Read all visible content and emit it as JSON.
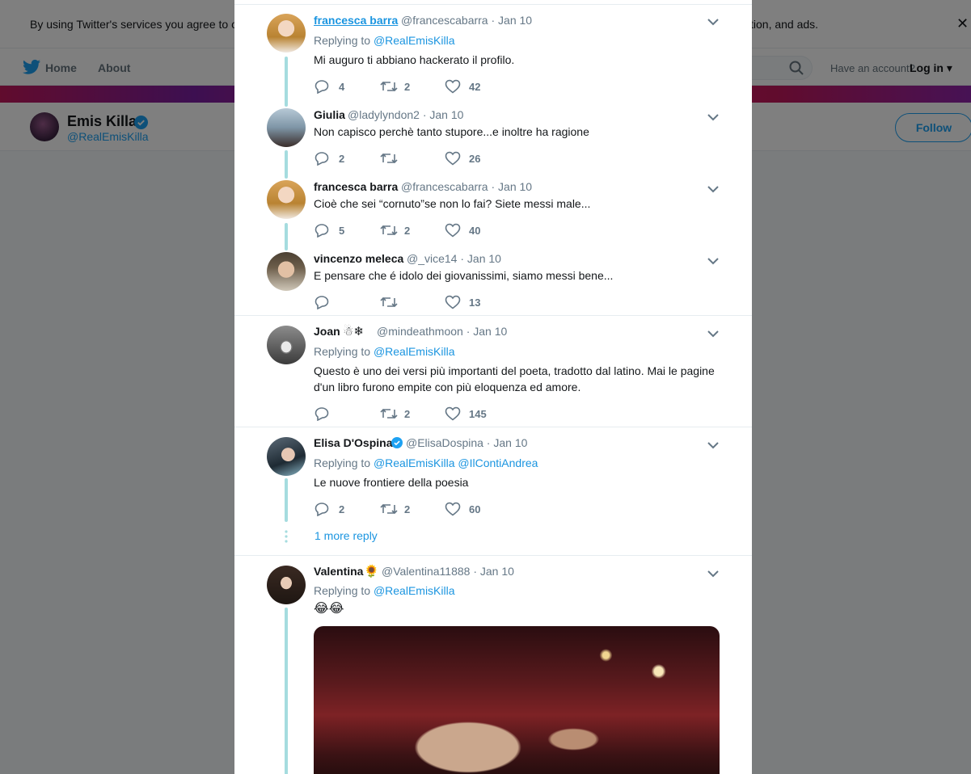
{
  "background": {
    "cookie_left": "By using Twitter's services you agree to o",
    "cookie_right": "tion, and ads.",
    "nav": {
      "home": "Home",
      "about": "About",
      "have_account": "Have an account?",
      "login": "Log in"
    },
    "profile": {
      "name": "Emis Killa",
      "handle": "@RealEmisKilla",
      "follow": "Follow"
    }
  },
  "tweets": [
    {
      "name": "francesca barra",
      "meta": "@francescabarra · Jan 10",
      "replying_prefix": "Replying to",
      "replying_to": "@RealEmisKilla",
      "text": "Mi auguro ti abbiano hackerato il profilo.",
      "replies": "4",
      "retweets": "2",
      "likes": "42"
    },
    {
      "name": "Giulia",
      "meta": "@ladylyndon2 · Jan 10",
      "text": "Non capisco perchè tanto stupore...e inoltre ha ragione",
      "replies": "2",
      "retweets": "",
      "likes": "26"
    },
    {
      "name": "francesca barra",
      "meta": "@francescabarra · Jan 10",
      "text": "Cioè che sei “cornuto”se non lo fai? Siete messi male...",
      "replies": "5",
      "retweets": "2",
      "likes": "40"
    },
    {
      "name": "vincenzo meleca",
      "meta": "@_vice14 · Jan 10",
      "text": "E pensare che é idolo dei giovanissimi, siamo messi bene...",
      "replies": "",
      "retweets": "",
      "likes": "13"
    },
    {
      "name": "Joan",
      "name_emoji": "☃❄",
      "meta": "@mindeathmoon · Jan 10",
      "replying_prefix": "Replying to",
      "replying_to": "@RealEmisKilla",
      "text_line1": "Questo è uno dei versi più importanti del poeta, tradotto dal latino. Mai le pagine",
      "text_line2": "d'un libro furono empite con più eloquenza ed amore.",
      "replies": "",
      "retweets": "2",
      "likes": "145"
    },
    {
      "name": "Elisa D'Ospina",
      "meta": "@ElisaDospina · Jan 10",
      "replying_prefix": "Replying to",
      "replying_to": "@RealEmisKilla @IlContiAndrea",
      "text": "Le nuove frontiere della poesia",
      "replies": "2",
      "retweets": "2",
      "likes": "60",
      "more_replies": "1 more reply"
    },
    {
      "name": "Valentina",
      "name_emoji": "🌻",
      "meta": "@Valentina11888 · Jan 10",
      "replying_prefix": "Replying to",
      "replying_to": "@RealEmisKilla",
      "text": "😂😂"
    }
  ],
  "icons": {
    "reply": "reply-icon",
    "retweet": "retweet-icon",
    "like": "heart-icon",
    "more": "chevron-down-icon",
    "verified": "verified-icon"
  },
  "colors": {
    "accent": "#1da1f2",
    "link": "#1b95e0",
    "thread": "#a5dcdf",
    "muted": "#657786"
  }
}
